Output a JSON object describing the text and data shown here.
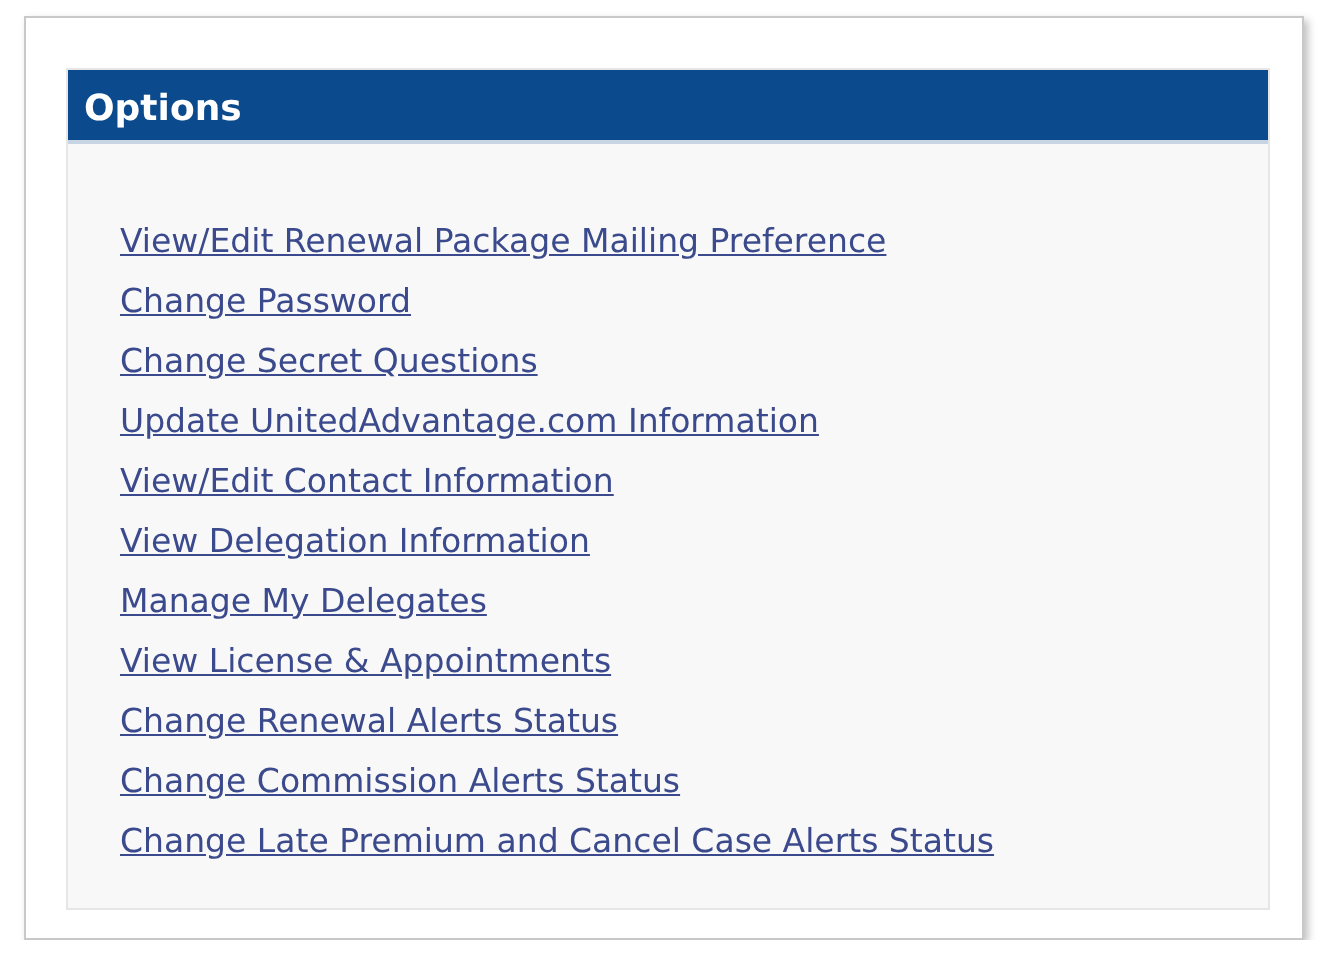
{
  "panel": {
    "title": "Options"
  },
  "links": [
    {
      "label": "View/Edit Renewal Package Mailing Preference"
    },
    {
      "label": "Change Password"
    },
    {
      "label": "Change Secret Questions"
    },
    {
      "label": "Update UnitedAdvantage.com Information"
    },
    {
      "label": "View/Edit Contact Information"
    },
    {
      "label": "View Delegation Information"
    },
    {
      "label": "Manage My Delegates"
    },
    {
      "label": "View License & Appointments"
    },
    {
      "label": "Change Renewal Alerts Status"
    },
    {
      "label": "Change Commission Alerts Status"
    },
    {
      "label": "Change Late Premium and Cancel Case Alerts Status"
    }
  ]
}
